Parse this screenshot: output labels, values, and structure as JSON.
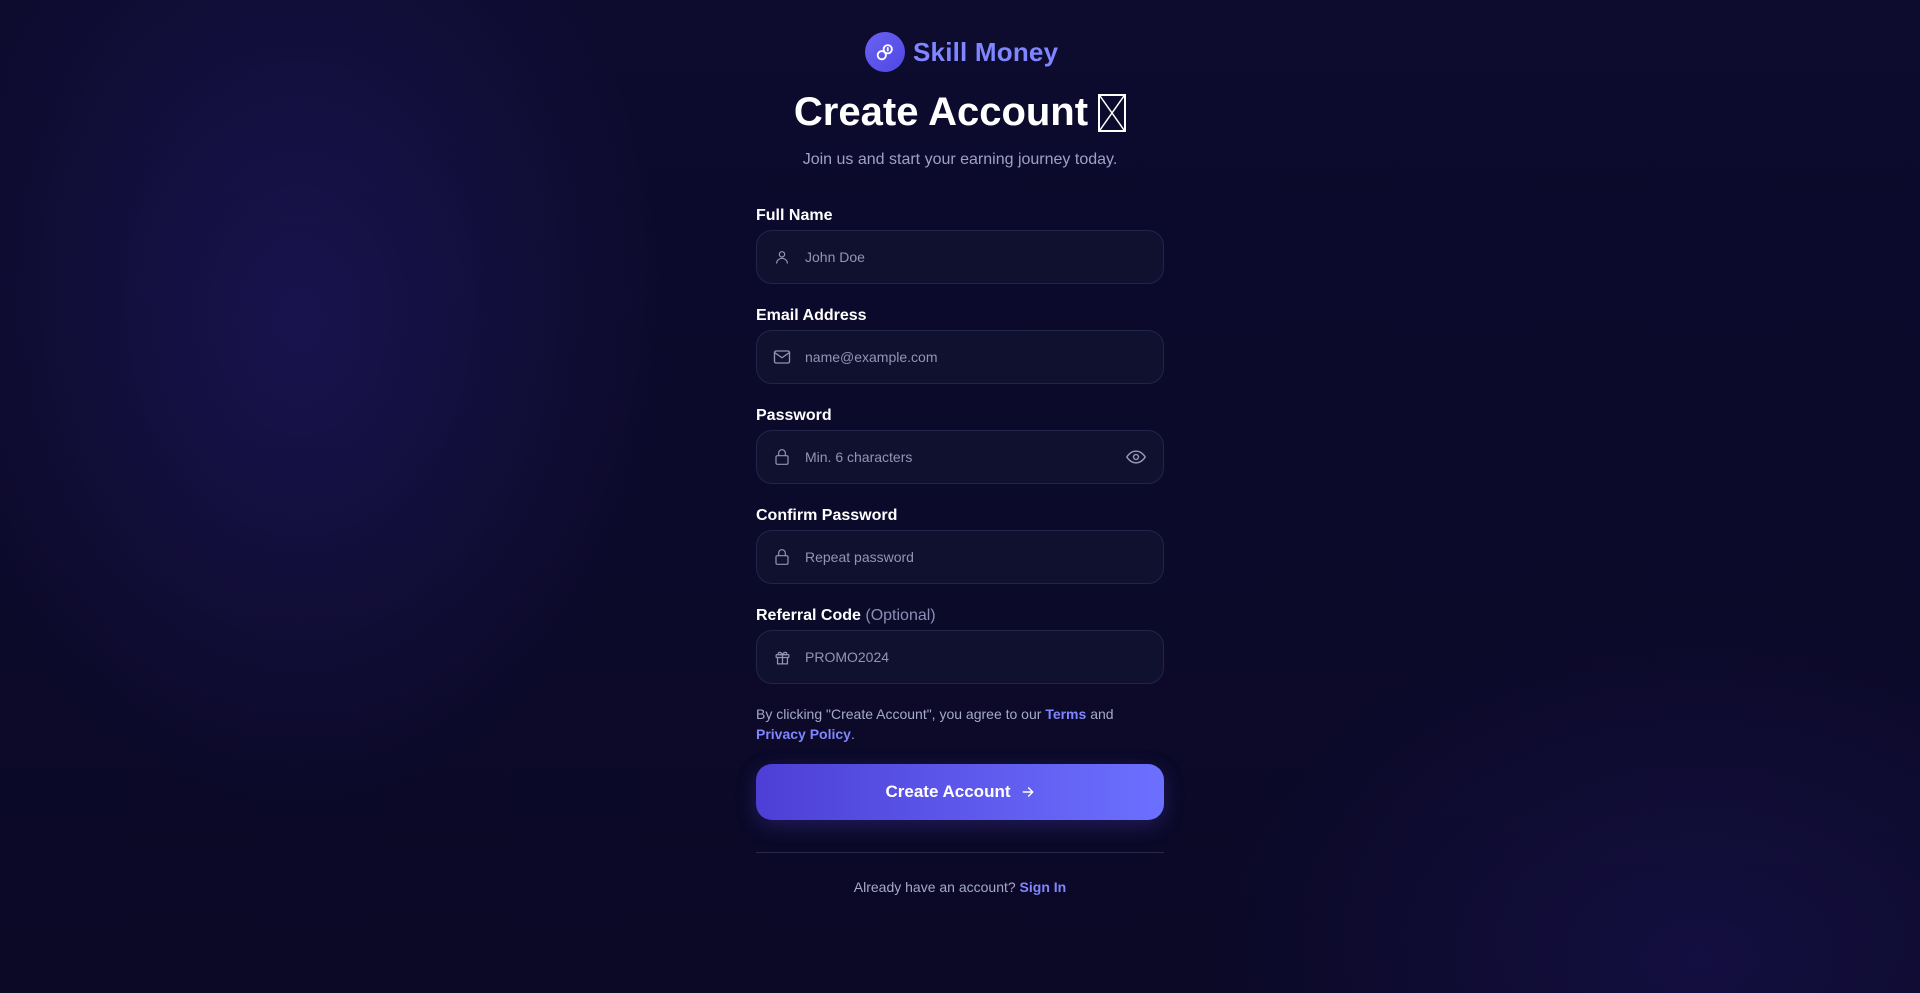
{
  "brand": {
    "name": "Skill Money",
    "accent_color": "#7f86ff"
  },
  "header": {
    "title": "Create Account",
    "subtitle": "Join us and start your earning journey today."
  },
  "form": {
    "full_name": {
      "label": "Full Name",
      "placeholder": "John Doe",
      "icon": "user-icon"
    },
    "email": {
      "label": "Email Address",
      "placeholder": "name@example.com",
      "icon": "mail-icon"
    },
    "password": {
      "label": "Password",
      "placeholder": "Min. 6 characters",
      "icon": "lock-icon",
      "toggle_icon": "eye-icon"
    },
    "confirm_password": {
      "label": "Confirm Password",
      "placeholder": "Repeat password",
      "icon": "lock-icon"
    },
    "referral": {
      "label": "Referral Code",
      "optional": "(Optional)",
      "placeholder": "PROMO2024",
      "icon": "gift-icon"
    },
    "terms": {
      "prefix": "By clicking \"Create Account\", you agree to our",
      "terms_link": "Terms",
      "and": "and",
      "privacy_link": "Privacy Policy",
      "suffix": "."
    },
    "submit_label": "Create Account",
    "submit_gradient": [
      "#4d3fd6",
      "#6c70ff"
    ]
  },
  "footer": {
    "prompt": "Already have an account?",
    "signin_link": "Sign In"
  }
}
